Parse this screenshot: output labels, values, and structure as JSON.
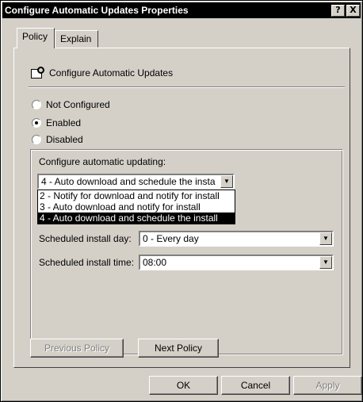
{
  "window": {
    "title": "Configure Automatic Updates Properties",
    "help_glyph": "?",
    "close_glyph": "X"
  },
  "tabs": [
    {
      "label": "Policy",
      "active": true
    },
    {
      "label": "Explain",
      "active": false
    }
  ],
  "policy": {
    "icon": "policy-setting-icon",
    "name": "Configure Automatic Updates"
  },
  "radio_options": [
    {
      "label": "Not Configured",
      "checked": false
    },
    {
      "label": "Enabled",
      "checked": true
    },
    {
      "label": "Disabled",
      "checked": false
    }
  ],
  "config": {
    "label": "Configure automatic updating:",
    "selected_value": "4 - Auto download and schedule the insta",
    "dropdown_options": [
      {
        "label": "2 - Notify for download and notify for install",
        "selected": false
      },
      {
        "label": "3 - Auto download and notify for install",
        "selected": false
      },
      {
        "label": "4 - Auto download and schedule the install",
        "selected": true
      }
    ],
    "install_day_label": "Scheduled install day:",
    "install_day_value": "0 - Every day",
    "install_time_label": "Scheduled install time:",
    "install_time_value": "08:00"
  },
  "nav": {
    "previous_label": "Previous Policy",
    "next_label": "Next Policy"
  },
  "buttons": {
    "ok": "OK",
    "cancel": "Cancel",
    "apply": "Apply"
  },
  "colors": {
    "face": "#d4d0c8",
    "titlebar": "#000000",
    "selection": "#000000"
  }
}
